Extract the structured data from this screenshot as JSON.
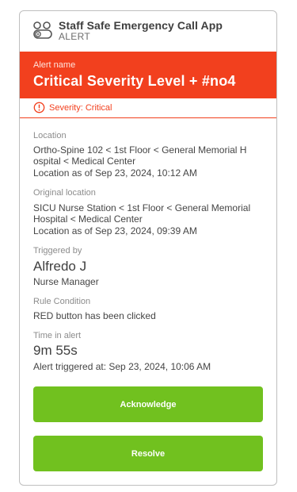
{
  "app": {
    "name": "Staff Safe Emergency Call App",
    "subtitle": "ALERT"
  },
  "alert": {
    "name_label": "Alert name",
    "name": "Critical Severity Level + #no4",
    "severity_text": "Severity: Critical"
  },
  "location": {
    "label": "Location",
    "path_line1": "Ortho-Spine 102 < 1st Floor < General Memorial H",
    "path_line2": "ospital < Medical Center",
    "as_of": "Location as of Sep 23, 2024, 10:12 AM"
  },
  "original_location": {
    "label": "Original location",
    "path_line1": "SICU Nurse Station < 1st Floor < General Memorial",
    "path_line2": "Hospital < Medical Center",
    "as_of": "Location as of Sep 23, 2024, 09:39 AM"
  },
  "triggered_by": {
    "label": "Triggered by",
    "name": "Alfredo J",
    "role": "Nurse Manager"
  },
  "rule_condition": {
    "label": "Rule Condition",
    "text": "RED button has been clicked"
  },
  "time_in_alert": {
    "label": "Time in alert",
    "duration": "9m 55s",
    "triggered_at": "Alert triggered at: Sep 23, 2024, 10:06 AM"
  },
  "actions": {
    "acknowledge": "Acknowledge",
    "resolve": "Resolve"
  },
  "colors": {
    "alert_red": "#f2401e",
    "button_green": "#71c11f"
  },
  "icons": {
    "app": "staff-group-icon",
    "severity": "exclamation-circle-icon"
  }
}
